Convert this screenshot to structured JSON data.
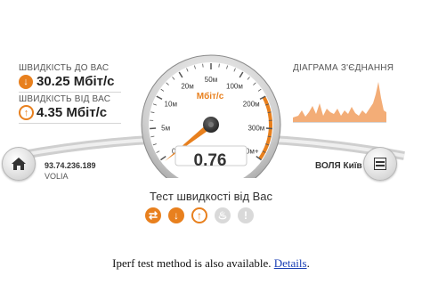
{
  "download": {
    "label": "ШВИДКІСТЬ ДО ВАС",
    "value": "30.25 Мбіт/с",
    "icon": "download-arrow-icon"
  },
  "upload": {
    "label": "ШВИДКІСТЬ ВІД ВАС",
    "value": "4.35 Мбіт/с",
    "icon": "upload-arrow-icon"
  },
  "chart": {
    "label": "ДІАГРАМА З'ЄДНАННЯ",
    "fill_color": "#f0a060"
  },
  "gauge": {
    "unit": "Мбіт/с",
    "reading": "0.76",
    "reading_value": 0.76,
    "ticks": [
      "0",
      "5м",
      "10м",
      "20м",
      "50м",
      "100м",
      "200м",
      "300м",
      "500м+"
    ],
    "tick_values": [
      0,
      5,
      10,
      20,
      50,
      100,
      200,
      300,
      500
    ]
  },
  "client": {
    "ip": "93.74.236.189",
    "isp": "VOLIA",
    "home_icon": "home-icon"
  },
  "server": {
    "name": "ВОЛЯ Київ",
    "menu_icon": "list-menu-icon"
  },
  "test": {
    "title": "Тест швидкості від Вас",
    "buttons": [
      {
        "name": "ping-button",
        "icon": "swap-icon",
        "glyph": "⇄",
        "state": "active"
      },
      {
        "name": "download-button",
        "icon": "download-icon",
        "glyph": "↓",
        "state": "active"
      },
      {
        "name": "upload-button",
        "icon": "upload-icon",
        "glyph": "↑",
        "state": "outlined"
      },
      {
        "name": "flame-button",
        "icon": "flame-icon",
        "glyph": "♨",
        "state": "disabled"
      },
      {
        "name": "alert-button",
        "icon": "exclamation-icon",
        "glyph": "!",
        "state": "disabled"
      }
    ]
  },
  "footer": {
    "text": "Iperf test method is also available. ",
    "link": "Details",
    "end": "."
  },
  "colors": {
    "accent": "#e8801e",
    "needle": "#e8801e"
  }
}
